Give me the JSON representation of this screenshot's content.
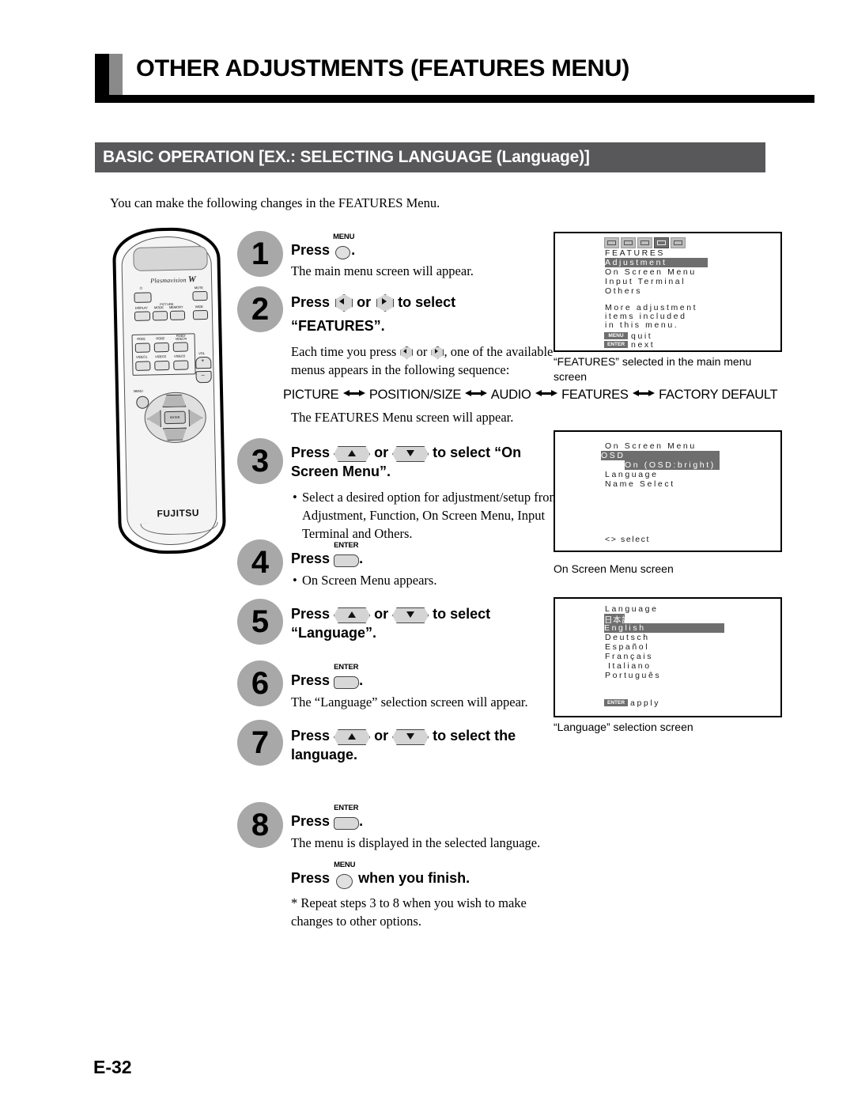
{
  "header": {
    "title": "OTHER ADJUSTMENTS (FEATURES MENU)",
    "section_bar": "BASIC OPERATION [EX.: SELECTING LANGUAGE (Language)]"
  },
  "intro": "You can make the following changes  in the FEATURES Menu.",
  "remote": {
    "brand": "Plasmavision",
    "brand_mark": "W",
    "maker": "FUJITSU",
    "buttons": {
      "power": "⏻",
      "mute": "MUTE",
      "display": "DISPLAY",
      "picture_bracket": "PICTURE",
      "mode": "MODE",
      "memory": "MEMORY",
      "wide": "WIDE",
      "rgb1": "RGB1",
      "rgb2": "RGB2",
      "rgb3_video4": "RGB3/\nVIDEO4",
      "video1": "VIDEO1",
      "video2": "VIDEO2",
      "video3": "VIDEO3",
      "vol": "VOL",
      "vol_up": "+",
      "vol_down": "–",
      "menu": "MENU",
      "enter": "ENTER"
    }
  },
  "steps": [
    {
      "number": "1",
      "head_pre": "Press",
      "glyph": "menu",
      "glyph_label": "MENU",
      "head_post": ".",
      "sub": [
        "The main menu screen will appear."
      ]
    },
    {
      "number": "2",
      "head_pre": "Press",
      "head_mid": "or",
      "head_post": "to select",
      "head_line2": "“FEATURES”.",
      "sub_a": "Each time you press",
      "sub_b": "or",
      "sub_c": ", one of the available",
      "sub_d": "menus appears in the following sequence:",
      "sequence": [
        "PICTURE",
        "POSITION/SIZE",
        "AUDIO",
        "FEATURES",
        "FACTORY DEFAULT"
      ],
      "sub_end": "The FEATURES Menu screen will appear."
    },
    {
      "number": "3",
      "head_pre": "Press",
      "head_mid": "or",
      "head_post": "to select “On",
      "head_line2": "Screen Menu”.",
      "sub": [
        "Select a desired option for adjustment/setup from Adjustment, Function, On Screen Menu, Input Terminal and Others."
      ]
    },
    {
      "number": "4",
      "head_pre": "Press",
      "glyph": "enter",
      "glyph_label": "ENTER",
      "head_post": ".",
      "sub": [
        "On Screen Menu appears."
      ]
    },
    {
      "number": "5",
      "head_pre": "Press",
      "head_mid": "or",
      "head_post": "to select",
      "head_line2": "“Language”."
    },
    {
      "number": "6",
      "head_pre": "Press",
      "glyph": "enter",
      "glyph_label": "ENTER",
      "head_post": ".",
      "sub": [
        "The “Language” selection screen will appear."
      ]
    },
    {
      "number": "7",
      "head_pre": "Press",
      "head_mid": "or",
      "head_post": "to select the",
      "head_line2": "language."
    },
    {
      "number": "8",
      "head_pre": "Press",
      "glyph": "enter",
      "glyph_label": "ENTER",
      "head_post": ".",
      "sub": [
        "The menu is displayed in the selected language."
      ]
    }
  ],
  "finish": {
    "pre": "Press",
    "glyph_label": "MENU",
    "post": "when you finish.",
    "note": "* Repeat steps 3 to 8 when you wish to make changes to other options."
  },
  "osd_features": {
    "title": "FEATURES",
    "items": [
      "Adjustment",
      "On Screen Menu",
      "Input Terminal",
      "Others"
    ],
    "selected": "Adjustment",
    "help": [
      "More adjustment",
      "items included",
      "in this menu."
    ],
    "footer": [
      {
        "key": "MENU",
        "action": "quit"
      },
      {
        "key": "ENTER",
        "action": "next"
      }
    ],
    "caption": "“FEATURES” selected in the main menu screen"
  },
  "osd_onscreen": {
    "title": "On Screen Menu",
    "items": [
      "OSD",
      "Language",
      "Name Select"
    ],
    "selected": "OSD",
    "osd_value": "On (OSD:bright)",
    "footer_hint": "<>  select",
    "caption": "On Screen Menu screen"
  },
  "osd_language": {
    "title": "Language",
    "items": [
      "日本語",
      "English",
      "Deutsch",
      "Español",
      "Français",
      "Italiano",
      "Português"
    ],
    "selected": "English",
    "footer": {
      "key": "ENTER",
      "action": "apply"
    },
    "caption": "“Language” selection screen"
  },
  "page_number": "E-32"
}
